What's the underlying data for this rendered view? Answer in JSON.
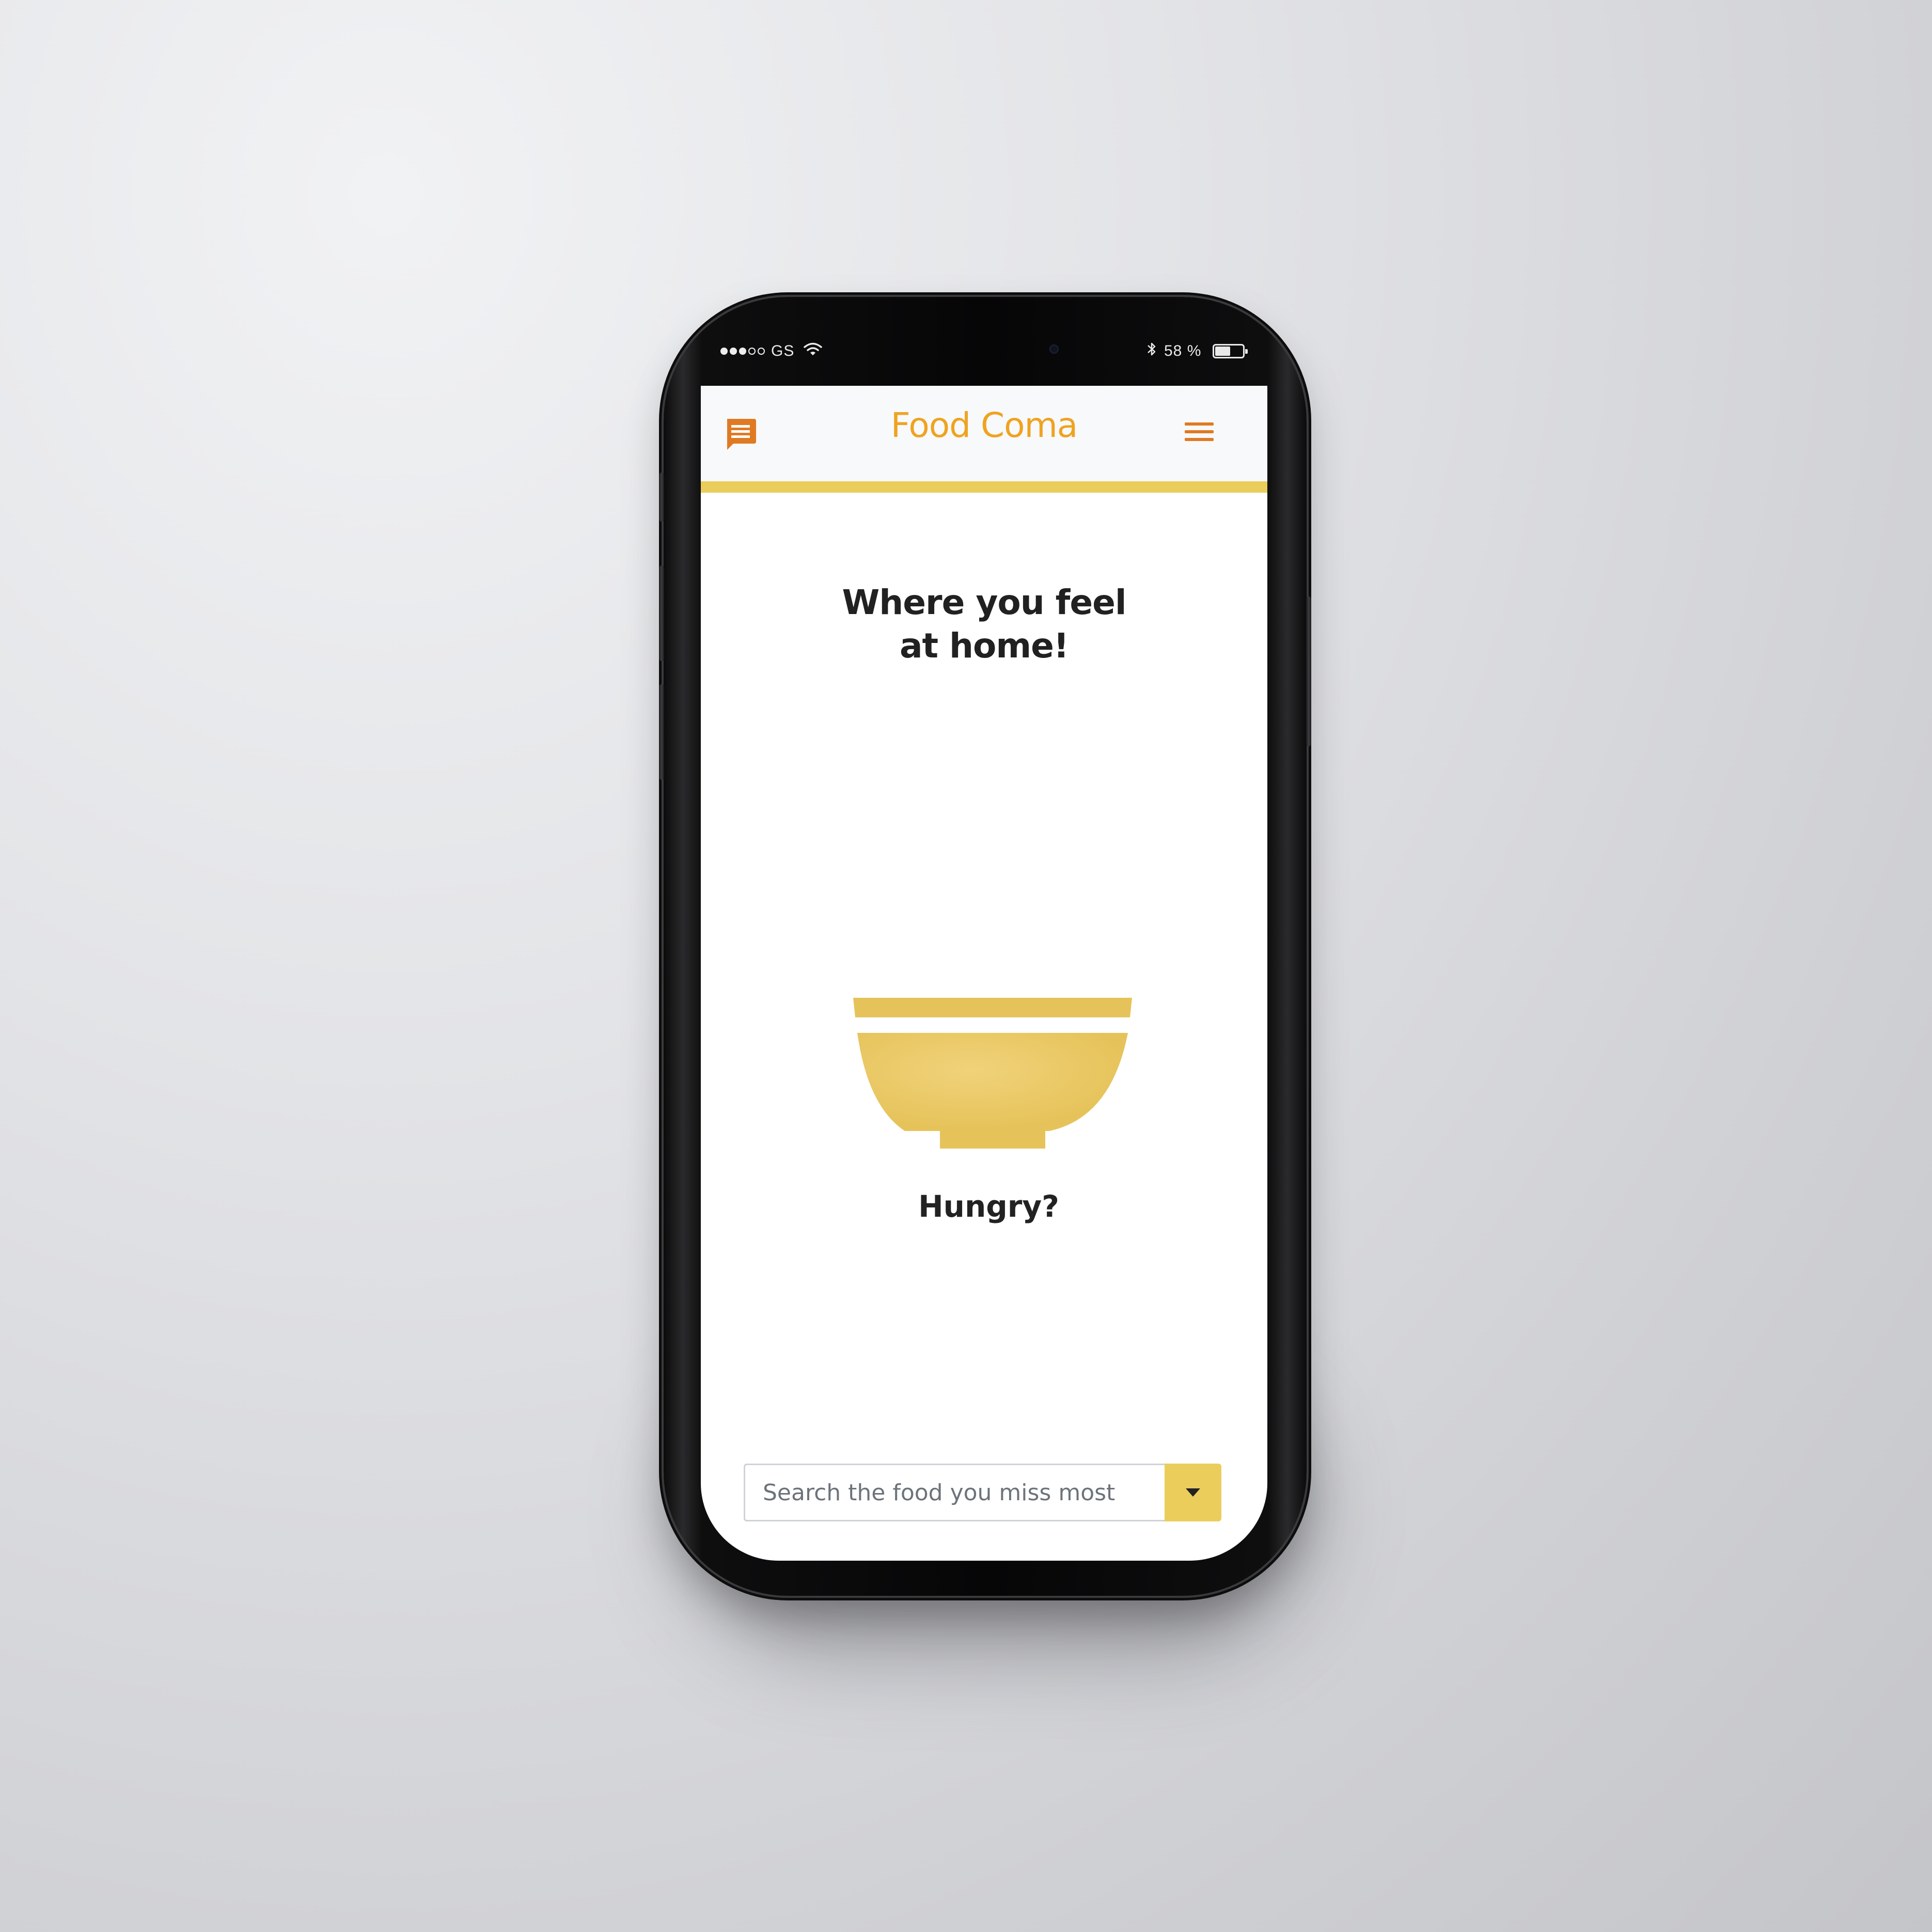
{
  "status_bar": {
    "carrier": "GS",
    "signal_bars_filled": 3,
    "signal_bars_total": 5,
    "battery_percent": "58 %",
    "battery_level": 0.58,
    "icons": [
      "wifi-icon",
      "bluetooth-icon",
      "battery-icon"
    ]
  },
  "header": {
    "title": "Food Coma",
    "left_icon": "chat-icon",
    "right_icon": "hamburger-menu-icon"
  },
  "main": {
    "headline": "Where you feel at home!",
    "illustration_icon": "bowl-icon",
    "prompt": "Hungry?"
  },
  "search": {
    "placeholder": "Search the food you miss most",
    "value": "",
    "dropdown_icon": "caret-down-icon"
  },
  "colors": {
    "accent_orange": "#efa321",
    "accent_dark_orange": "#e07a22",
    "accent_yellow": "#ebcd5c",
    "bowl_yellow": "#e8c75e",
    "header_bg": "#f8f9fa",
    "text_dark": "#212121"
  }
}
